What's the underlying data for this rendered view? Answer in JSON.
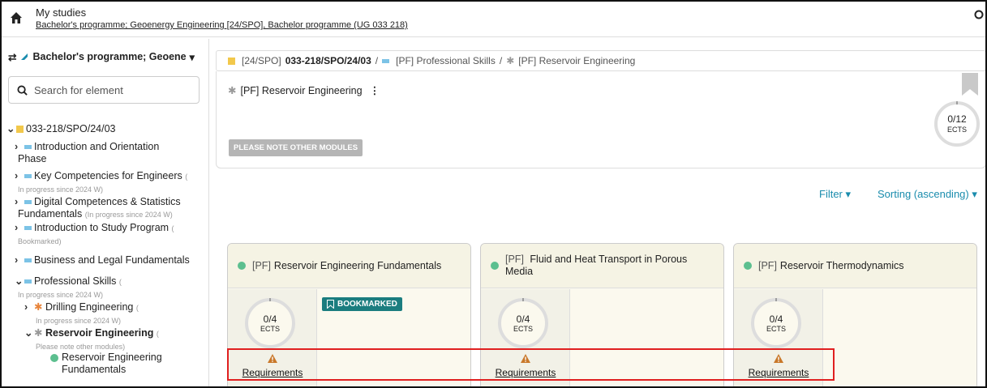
{
  "header": {
    "title": "My studies",
    "subtitle": "Bachelor's programme; Geoenergy Engineering [24/SPO], Bachelor programme (UG 033 218)"
  },
  "sidebar": {
    "program_select": "Bachelor's programme; Geoene",
    "search_placeholder": "Search for element",
    "tree": {
      "root": "033-218/SPO/24/03",
      "items": [
        {
          "label": "Introduction and Orientation",
          "label2": "Phase",
          "sub": ""
        },
        {
          "label": "Key Competencies for Engineers",
          "label2": "",
          "sub": "In progress since 2024 W)"
        },
        {
          "label": "Digital Competences & Statistics",
          "label2": "Fundamentals",
          "sub": "(In progress since 2024 W)"
        },
        {
          "label": "Introduction to Study Program",
          "label2": "",
          "sub": "Bookmarked)"
        },
        {
          "label": "Business and Legal Fundamentals",
          "label2": "",
          "sub": ""
        },
        {
          "label": "Professional Skills",
          "label2": "",
          "sub": "In progress since 2024 W)"
        },
        {
          "label": "Drilling Engineering",
          "label2": "",
          "sub": "In progress since 2024 W)"
        },
        {
          "label": "Reservoir Engineering",
          "label2": "",
          "sub": "Please note other modules)"
        },
        {
          "label": "Reservoir Engineering",
          "label2": "Fundamentals",
          "sub": ""
        }
      ]
    }
  },
  "breadcrumb": {
    "part1_prefix": "[24/SPO]",
    "part1": "033-218/SPO/24/03",
    "part2": "[PF] Professional Skills",
    "part3": "[PF] Reservoir Engineering"
  },
  "node": {
    "title": "[PF] Reservoir Engineering",
    "note_badge": "PLEASE NOTE OTHER MODULES",
    "ects": "0/12",
    "ects_unit": "ECTS"
  },
  "toolbar": {
    "filter": "Filter",
    "sorting": "Sorting (ascending)"
  },
  "cards": [
    {
      "prefix": "[PF]",
      "title": "Reservoir Engineering Fundamentals",
      "title2": "",
      "ects": "0/4",
      "unit": "ECTS",
      "requirements": "Requirements",
      "badge": "BOOKMARKED"
    },
    {
      "prefix": "[PF]",
      "title": "Fluid and Heat Transport in Porous",
      "title2": "Media",
      "ects": "0/4",
      "unit": "ECTS",
      "requirements": "Requirements",
      "badge": ""
    },
    {
      "prefix": "[PF]",
      "title": "Reservoir Thermodynamics",
      "title2": "",
      "ects": "0/4",
      "unit": "ECTS",
      "requirements": "Requirements",
      "badge": ""
    }
  ],
  "colors": {
    "accent": "#1a8cad",
    "bookmark_teal": "#1b7d7f",
    "highlight_red": "#e02020",
    "module_green": "#5cbf8f",
    "program_yellow": "#f2c84b",
    "section_blue": "#7cc3e6"
  }
}
